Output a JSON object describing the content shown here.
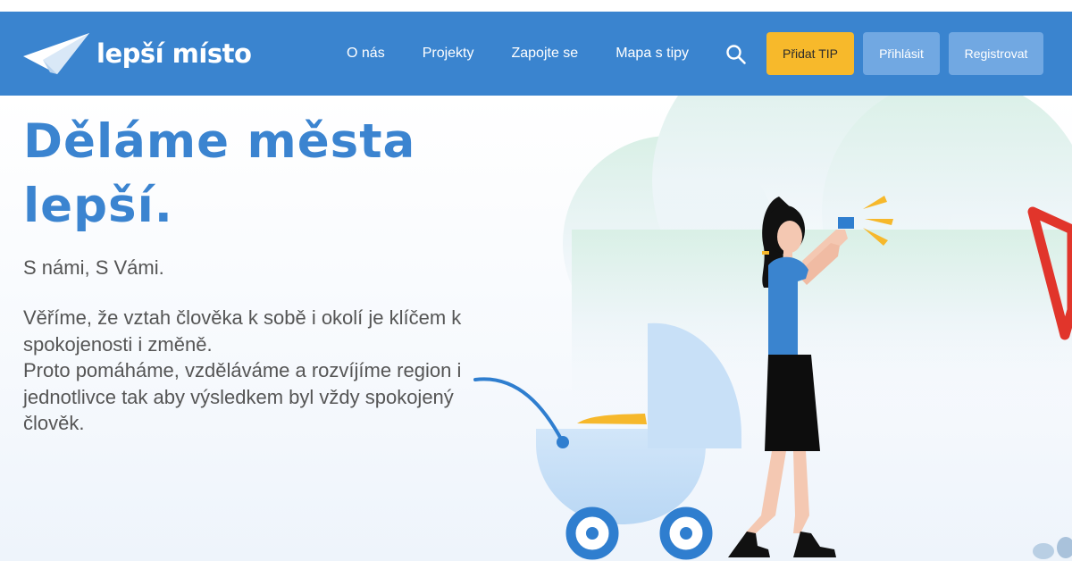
{
  "brand": {
    "name": "lepší místo",
    "logo_icon": "paper-plane-icon"
  },
  "nav": {
    "links": [
      "O nás",
      "Projekty",
      "Zapojte se",
      "Mapa s tipy"
    ],
    "search_icon": "search-icon",
    "buttons": {
      "add_tip": "Přidat TIP",
      "login": "Přihlásit",
      "register": "Registrovat"
    }
  },
  "hero": {
    "title_line1": "Děláme města",
    "title_line2": "lepší.",
    "subtitle": "S námi, S Vámi.",
    "description_lines": [
      "Věříme, že vztah člověka k sobě i okolí je klíčem k",
      "spokojenosti i změně.",
      "Proto pomáháme, vzděláváme a rozvíjíme region i",
      "jednotlivce tak aby výsledkem byl vždy spokojený",
      "člověk."
    ]
  },
  "colors": {
    "navbar": "#3a84cf",
    "title": "#3b84d0",
    "text": "#555555",
    "button_tip": "#f7b92b",
    "button_secondary": "#71a8e2"
  }
}
